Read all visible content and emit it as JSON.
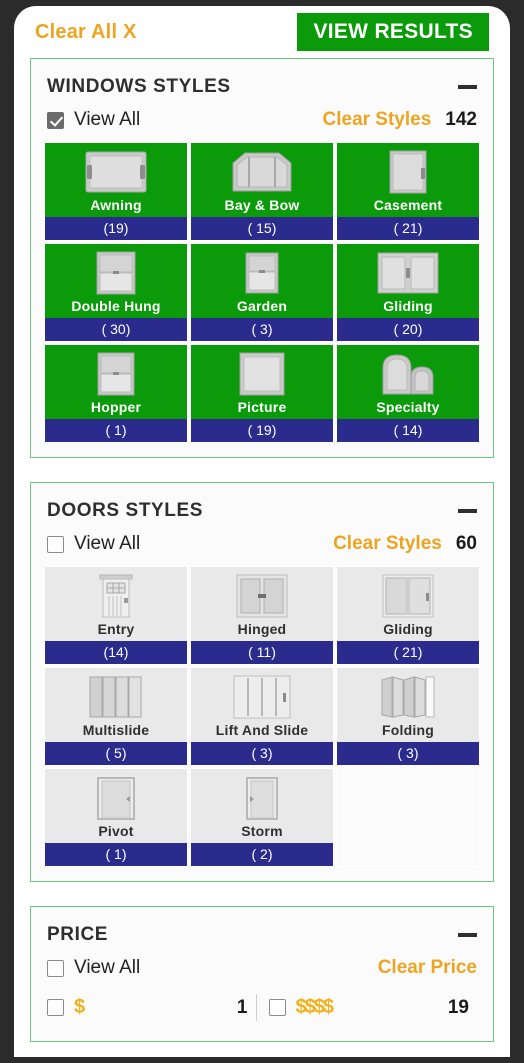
{
  "colors": {
    "green": "#0a9a0a",
    "orange": "#eda421",
    "navy": "#2b2b8e",
    "card_border": "#6ec87c",
    "tile_gray": "#e9e9e9"
  },
  "topbar": {
    "clear_all_label": "Clear All X",
    "view_results_label": "VIEW RESULTS"
  },
  "sections": [
    {
      "key": "windows",
      "title": "WINDOWS STYLES",
      "collapse_icon": "minus-icon",
      "view_all_label": "View All",
      "view_all_checked": true,
      "clear_label": "Clear Styles",
      "count": "142",
      "tiles": [
        {
          "label": "Awning",
          "count": "(19)",
          "icon": "awning-window-icon"
        },
        {
          "label": "Bay & Bow",
          "count": "( 15)",
          "icon": "bay-bow-window-icon"
        },
        {
          "label": "Casement",
          "count": "( 21)",
          "icon": "casement-window-icon"
        },
        {
          "label": "Double Hung",
          "count": "( 30)",
          "icon": "double-hung-window-icon"
        },
        {
          "label": "Garden",
          "count": "( 3)",
          "icon": "garden-window-icon"
        },
        {
          "label": "Gliding",
          "count": "( 20)",
          "icon": "gliding-window-icon"
        },
        {
          "label": "Hopper",
          "count": "( 1)",
          "icon": "hopper-window-icon"
        },
        {
          "label": "Picture",
          "count": "( 19)",
          "icon": "picture-window-icon"
        },
        {
          "label": "Specialty",
          "count": "( 14)",
          "icon": "specialty-window-icon"
        }
      ]
    },
    {
      "key": "doors",
      "title": "DOORS STYLES",
      "collapse_icon": "minus-icon",
      "view_all_label": "View All",
      "view_all_checked": false,
      "clear_label": "Clear Styles",
      "count": "60",
      "tiles": [
        {
          "label": "Entry",
          "count": "(14)",
          "icon": "entry-door-icon"
        },
        {
          "label": "Hinged",
          "count": "( 11)",
          "icon": "hinged-door-icon"
        },
        {
          "label": "Gliding",
          "count": "( 21)",
          "icon": "gliding-door-icon"
        },
        {
          "label": "Multislide",
          "count": "( 5)",
          "icon": "multislide-door-icon"
        },
        {
          "label": "Lift And Slide",
          "count": "( 3)",
          "icon": "lift-and-slide-door-icon"
        },
        {
          "label": "Folding",
          "count": "( 3)",
          "icon": "folding-door-icon"
        },
        {
          "label": "Pivot",
          "count": "( 1)",
          "icon": "pivot-door-icon"
        },
        {
          "label": "Storm",
          "count": "( 2)",
          "icon": "storm-door-icon"
        }
      ]
    }
  ],
  "price": {
    "title": "PRICE",
    "collapse_icon": "minus-icon",
    "view_all_label": "View All",
    "view_all_checked": false,
    "clear_label": "Clear Price",
    "options": [
      {
        "symbol": "$",
        "count": "1",
        "checked": false
      },
      {
        "symbol": "$$$$",
        "count": "19",
        "checked": false
      }
    ]
  }
}
